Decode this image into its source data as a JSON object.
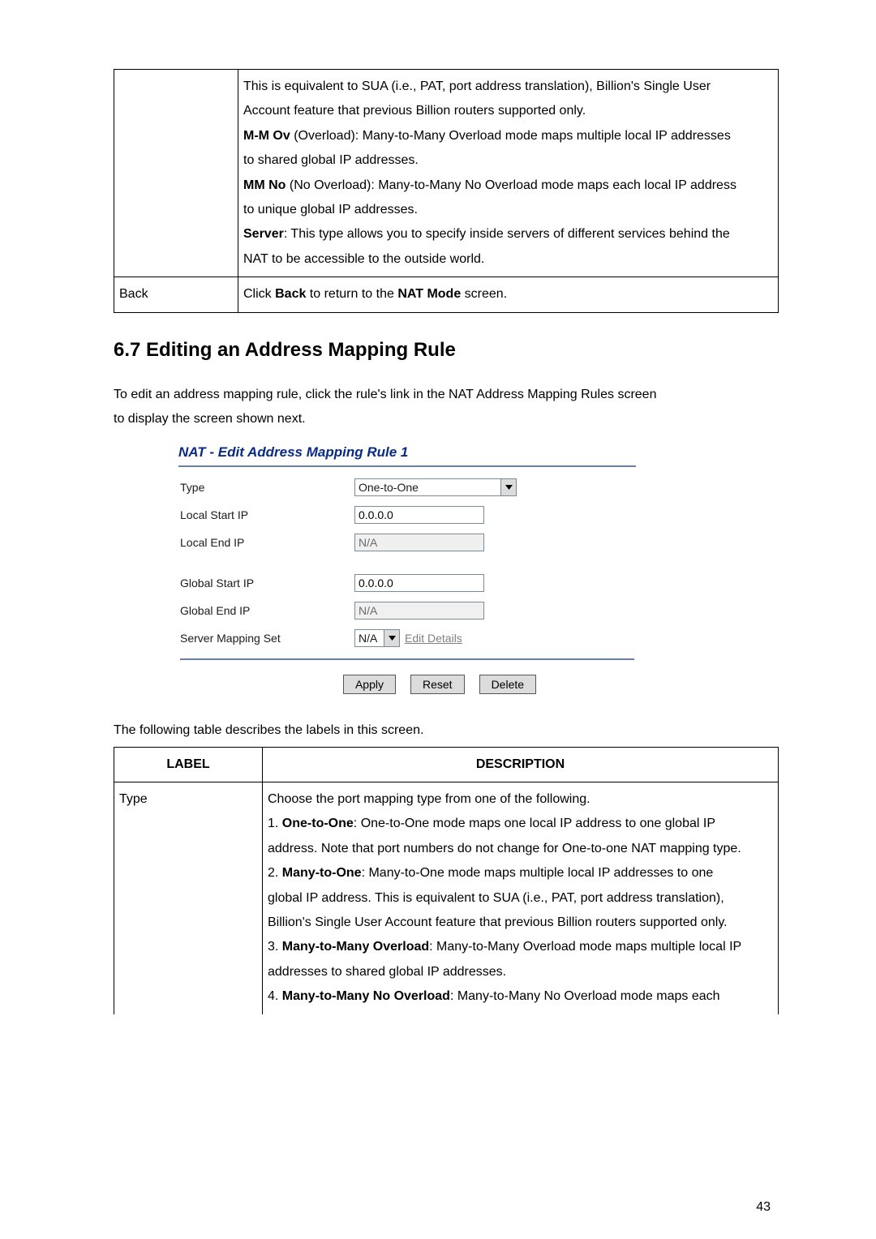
{
  "table1": {
    "desc_lines": [
      {
        "t": "This is equivalent to SUA (i.e., PAT, port address translation), Billion's Single User"
      },
      {
        "t": "Account feature that previous Billion routers supported only."
      },
      {
        "b": "M-M Ov",
        "t": " (Overload): Many-to-Many Overload mode maps multiple local IP addresses"
      },
      {
        "t": "to shared global IP addresses."
      },
      {
        "b": "MM No",
        "t": " (No Overload): Many-to-Many No Overload mode maps each local IP address"
      },
      {
        "t": "to unique global IP addresses."
      },
      {
        "b": "Server",
        "t": ": This type allows you to specify inside servers of different services behind the"
      },
      {
        "t": "NAT to be accessible to the outside world."
      }
    ],
    "row2_label": "Back",
    "row2_pre": "Click ",
    "row2_b1": "Back",
    "row2_mid": " to return to the ",
    "row2_b2": "NAT Mode",
    "row2_post": " screen."
  },
  "section_heading": "6.7 Editing an Address Mapping Rule",
  "para1_a": "To edit an address mapping rule, click the rule's link in the NAT Address Mapping Rules screen",
  "para1_b": "to display the screen shown next.",
  "form": {
    "title": "NAT - Edit Address Mapping Rule 1",
    "type_label": "Type",
    "type_value": "One-to-One",
    "lsip_label": "Local Start IP",
    "lsip_value": "0.0.0.0",
    "leip_label": "Local End IP",
    "leip_value": "N/A",
    "gsip_label": "Global Start IP",
    "gsip_value": "0.0.0.0",
    "geip_label": "Global End IP",
    "geip_value": "N/A",
    "sms_label": "Server Mapping Set",
    "sms_value": "N/A",
    "edit_details": "Edit Details",
    "apply": "Apply",
    "reset": "Reset",
    "delete": "Delete"
  },
  "para2": "The following table describes the labels in this screen.",
  "table2": {
    "h1": "LABEL",
    "h2": "DESCRIPTION",
    "row_label": "Type",
    "lines": [
      {
        "t": "Choose the port mapping type from one of the following."
      },
      {
        "p": "1. ",
        "b": "One-to-One",
        "t": ": One-to-One mode maps one local IP address to one global IP"
      },
      {
        "t": "address. Note that port numbers do not change for One-to-one NAT mapping type."
      },
      {
        "p": "2. ",
        "b": "Many-to-One",
        "t": ": Many-to-One mode maps multiple local IP addresses to one"
      },
      {
        "t": "global IP address. This is equivalent to SUA (i.e., PAT, port address translation),"
      },
      {
        "t": "Billion's Single User Account feature that previous Billion routers supported only."
      },
      {
        "p": "3. ",
        "b": "Many-to-Many Overload",
        "t": ": Many-to-Many Overload mode maps multiple local IP"
      },
      {
        "t": "addresses to shared global IP addresses."
      },
      {
        "p": "4. ",
        "b": "Many-to-Many No Overload",
        "t": ": Many-to-Many No Overload mode maps each"
      }
    ]
  },
  "page_number": "43"
}
